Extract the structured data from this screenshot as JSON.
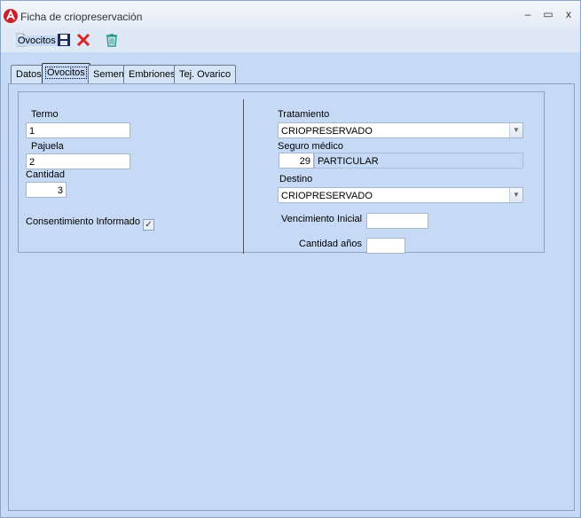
{
  "window": {
    "title": "Ficha de criopreservación",
    "minimize": "–",
    "maximize": "▭",
    "close": "x"
  },
  "toolbar": {
    "icons": [
      "new-document-icon",
      "open-folder-icon",
      "save-icon",
      "delete-x-icon",
      "trash-icon"
    ]
  },
  "tabs": [
    {
      "label": "Datos",
      "active": false
    },
    {
      "label": "Ovocitos",
      "active": true
    },
    {
      "label": "Semen",
      "active": false
    },
    {
      "label": "Embriones",
      "active": false
    },
    {
      "label": "Tej. Ovarico",
      "active": false
    }
  ],
  "ovocitos": {
    "group_title": "Ovocitos",
    "termo_label": "Termo",
    "termo_value": "1",
    "pajuela_label": "Pajuela",
    "pajuela_value": "2",
    "cantidad_label": "Cantidad",
    "cantidad_value": "3",
    "consentimiento_label": "Consentimiento Informado",
    "consentimiento_checked": true,
    "tratamiento_label": "Tratamiento",
    "tratamiento_value": "CRIOPRESERVADO",
    "seguro_label": "Seguro médico",
    "seguro_code": "29",
    "seguro_name": "PARTICULAR",
    "destino_label": "Destino",
    "destino_value": "CRIOPRESERVADO",
    "vencimiento_label": "Vencimiento Inicial",
    "vencimiento_value": "",
    "cantidad_anos_label": "Cantidad años",
    "cantidad_anos_value": ""
  },
  "colors": {
    "panel": "#c6daf6",
    "delete": "#e02020",
    "trash": "#2a9a8a",
    "brand": "#c8232c"
  }
}
